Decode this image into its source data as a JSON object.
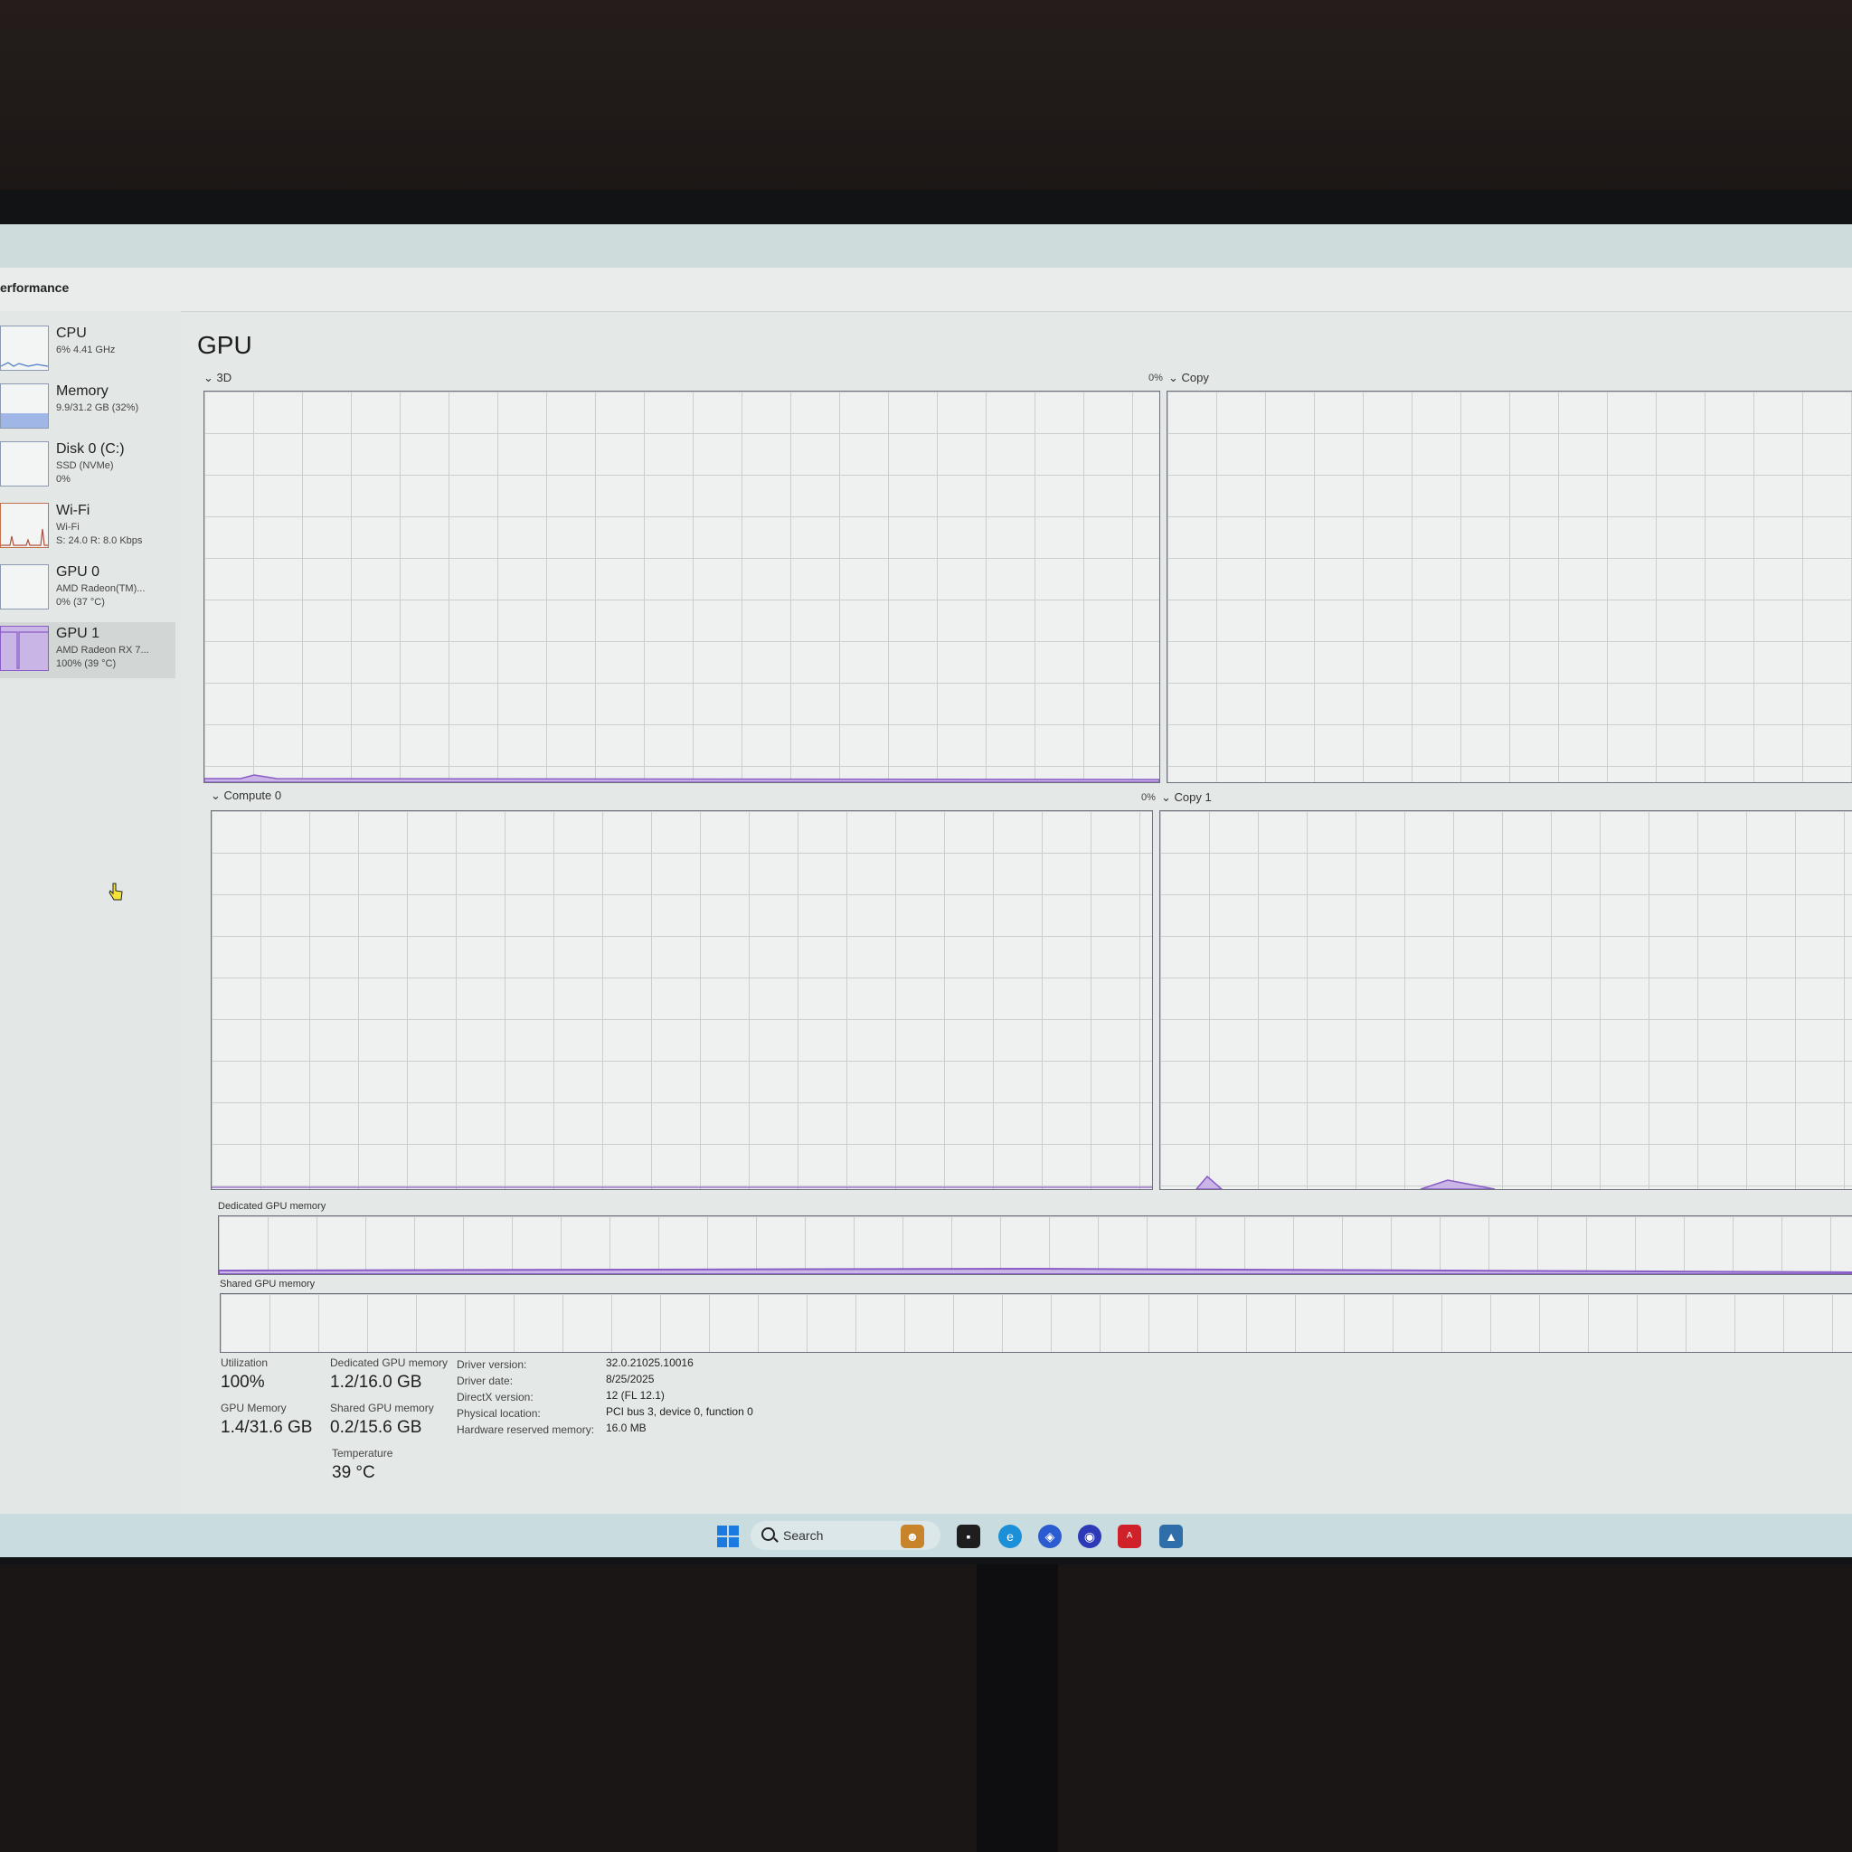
{
  "page_label": "erformance",
  "sidebar": {
    "items": [
      {
        "name": "CPU",
        "sub1": "6% 4.41 GHz",
        "sub2": "",
        "sub3": ""
      },
      {
        "name": "Memory",
        "sub1": "9.9/31.2 GB (32%)",
        "sub2": "",
        "sub3": ""
      },
      {
        "name": "Disk 0 (C:)",
        "sub1": "SSD (NVMe)",
        "sub2": "0%",
        "sub3": ""
      },
      {
        "name": "Wi-Fi",
        "sub1": "Wi-Fi",
        "sub2": "S: 24.0 R: 8.0 Kbps",
        "sub3": ""
      },
      {
        "name": "GPU 0",
        "sub1": "AMD Radeon(TM)...",
        "sub2": "0% (37 °C)",
        "sub3": ""
      },
      {
        "name": "GPU 1",
        "sub1": "AMD Radeon RX 7...",
        "sub2": "100% (39 °C)",
        "sub3": ""
      }
    ]
  },
  "main": {
    "title": "GPU",
    "engines": {
      "e1": {
        "label": "3D",
        "pct": "0%"
      },
      "e2": {
        "label": "Copy",
        "pct": ""
      },
      "e3": {
        "label": "Compute 0",
        "pct": "0%"
      },
      "e4": {
        "label": "Copy 1",
        "pct": ""
      }
    },
    "dedicated_label": "Dedicated GPU memory",
    "shared_label": "Shared GPU memory"
  },
  "stats": {
    "utilization_label": "Utilization",
    "utilization": "100%",
    "dedicated_label": "Dedicated GPU memory",
    "dedicated": "1.2/16.0 GB",
    "gpu_memory_label": "GPU Memory",
    "gpu_memory": "1.4/31.6 GB",
    "shared_label": "Shared GPU memory",
    "shared": "0.2/15.6 GB",
    "temperature_label": "Temperature",
    "temperature": "39 °C"
  },
  "properties": [
    {
      "key": "Driver version:",
      "value": "32.0.21025.10016"
    },
    {
      "key": "Driver date:",
      "value": "8/25/2025"
    },
    {
      "key": "DirectX version:",
      "value": "12 (FL 12.1)"
    },
    {
      "key": "Physical location:",
      "value": "PCI bus 3, device 0, function 0"
    },
    {
      "key": "Hardware reserved memory:",
      "value": "16.0 MB"
    }
  ],
  "taskbar": {
    "search_placeholder": "Search",
    "icons": [
      "windows-start-icon",
      "search-icon",
      "widgets-icon",
      "task-view-icon",
      "edge-icon",
      "copilot-icon",
      "discord-icon",
      "amd-software-icon",
      "task-manager-icon"
    ]
  },
  "colors": {
    "graph_line": "#8a5cc7",
    "graph_fill": "#c9b5e6",
    "memory_line": "#6b7fd0",
    "selected_bg": "#d2d7d6"
  }
}
